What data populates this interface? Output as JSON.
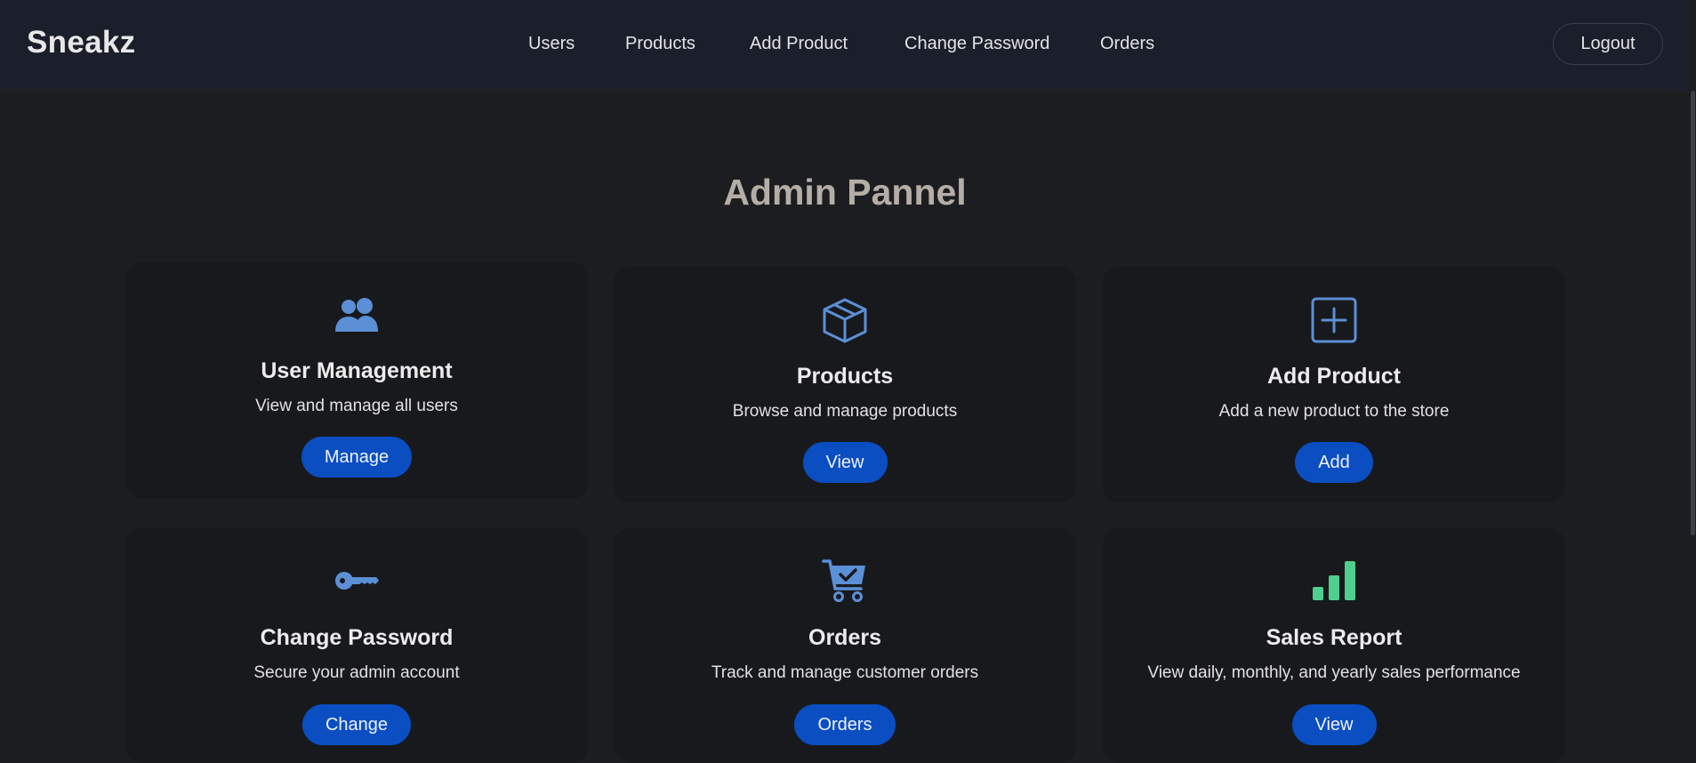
{
  "navbar": {
    "brand": "Sneakz",
    "links": [
      "Users",
      "Products",
      "Add Product",
      "Change Password",
      "Orders"
    ],
    "logout_label": "Logout"
  },
  "main": {
    "title": "Admin Pannel",
    "cards": [
      {
        "icon": "users-icon",
        "title": "User Management",
        "description": "View and manage all users",
        "button": "Manage"
      },
      {
        "icon": "box-icon",
        "title": "Products",
        "description": "Browse and manage products",
        "button": "View"
      },
      {
        "icon": "plus-square-icon",
        "title": "Add Product",
        "description": "Add a new product to the store",
        "button": "Add"
      },
      {
        "icon": "key-icon",
        "title": "Change Password",
        "description": "Secure your admin account",
        "button": "Change"
      },
      {
        "icon": "cart-check-icon",
        "title": "Orders",
        "description": "Track and manage customer orders",
        "button": "Orders"
      },
      {
        "icon": "bar-chart-icon",
        "title": "Sales Report",
        "description": "View daily, monthly, and yearly sales performance",
        "button": "View"
      }
    ]
  },
  "colors": {
    "navbar_bg": "#1a1f2b",
    "page_bg": "#1c1d20",
    "card_bg": "#18191c",
    "accent_blue": "#0b4ec2",
    "icon_blue": "#5b8fd6",
    "icon_green": "#4fcf8e",
    "title_color": "#b5aea7"
  }
}
